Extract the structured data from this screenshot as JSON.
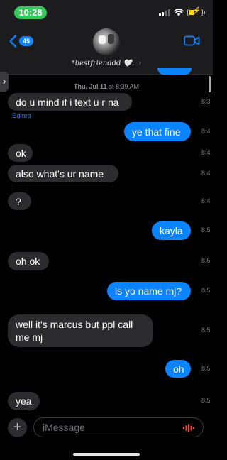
{
  "status_bar": {
    "time": "10:28"
  },
  "header": {
    "back_count": "45",
    "contact_name": "*bestfrienddd 🤍.",
    "chevron": "›"
  },
  "thread": {
    "date_label": "Thu, Jul 11",
    "time_label": "at 8:39 AM",
    "edited_label": "Edited",
    "messages": [
      {
        "side": "in",
        "text": "do u mind if i text u r na",
        "time": "8:3"
      },
      {
        "side": "out",
        "text": "ye that fine",
        "time": "8:4"
      },
      {
        "side": "in",
        "text": "ok",
        "time": "8:4"
      },
      {
        "side": "in",
        "text": "also what's ur name",
        "time": "8:4"
      },
      {
        "side": "in",
        "text": "?",
        "time": "8:4"
      },
      {
        "side": "out",
        "text": "kayla",
        "time": "8:5"
      },
      {
        "side": "in",
        "text": "oh ok",
        "time": "8:5"
      },
      {
        "side": "out",
        "text": "is yo name mj?",
        "time": "8:5"
      },
      {
        "side": "in",
        "text": "well it's marcus but ppl call me mj",
        "time": "8:5"
      },
      {
        "side": "out",
        "text": "oh",
        "time": "8:5"
      },
      {
        "side": "in",
        "text": "yea",
        "time": "8:5"
      }
    ]
  },
  "composer": {
    "placeholder": "iMessage"
  },
  "icons": {
    "back": "chevron-left-icon",
    "video": "video-camera-icon",
    "plus": "plus-icon",
    "mic": "audio-waveform-icon"
  },
  "colors": {
    "accent": "#0a84ff",
    "incoming": "#2c2c2e",
    "time_pill": "#34c759"
  }
}
